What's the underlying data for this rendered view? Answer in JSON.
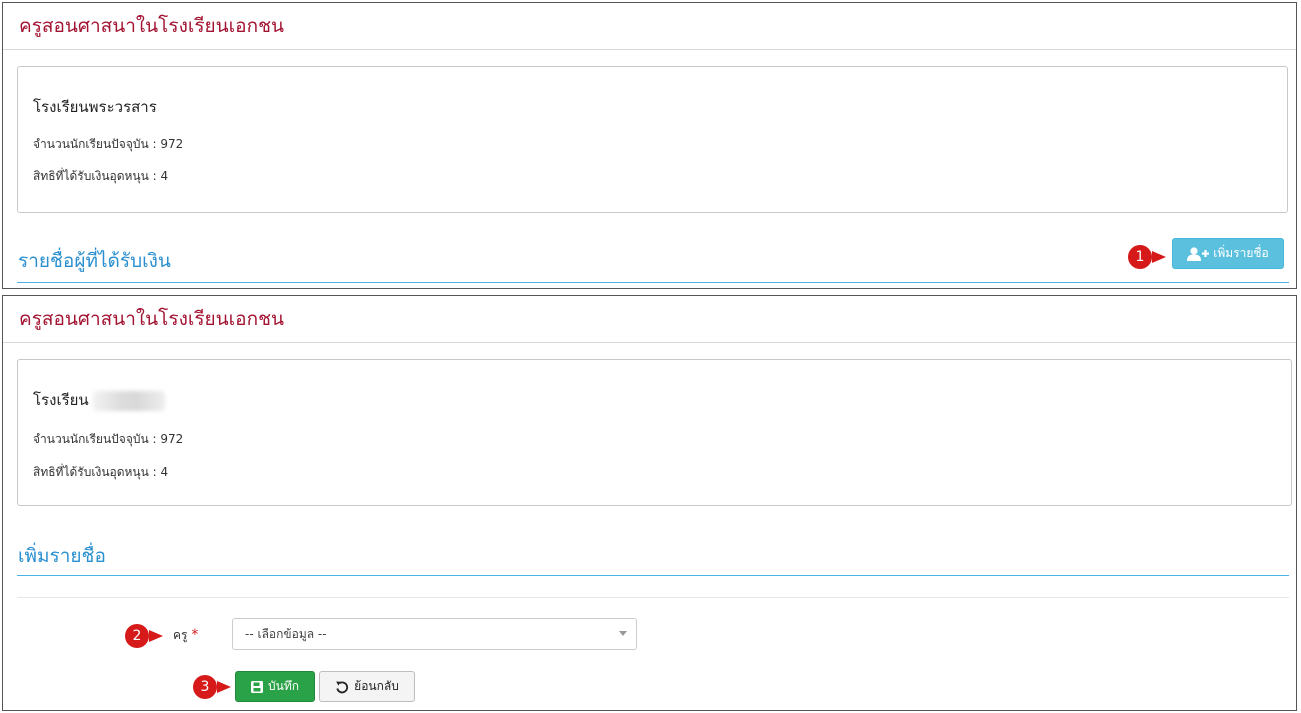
{
  "colors": {
    "header_title": "#a31432",
    "section_title": "#2a8fd0",
    "info_button": "#5bc0de",
    "save_button": "#2aa248",
    "badge": "#d61a1a"
  },
  "panel1": {
    "header_title": "ครูสอนศาสนาในโรงเรียนเอกชน",
    "school_name": "โรงเรียนพระวรสาร",
    "student_count": "จำนวนนักเรียนปัจจุบัน : 972",
    "subsidy_rights": "สิทธิที่ได้รับเงินอุดหนุน : 4",
    "section_title": "รายชื่อผู้ที่ได้รับเงิน",
    "add_button": {
      "label": "เพิ่มรายชื่อ",
      "icon": "user-plus-icon"
    },
    "step_badge": "1"
  },
  "panel2": {
    "header_title": "ครูสอนศาสนาในโรงเรียนเอกชน",
    "school_name": "โรงเรียน",
    "student_count": "จำนวนนักเรียนปัจจุบัน : 972",
    "subsidy_rights": "สิทธิที่ได้รับเงินอุดหนุน : 4",
    "section_title": "เพิ่มรายชื่อ",
    "teacher_label": "ครู",
    "required_mark": "*",
    "teacher_select_value": "-- เลือกข้อมูล --",
    "save_button": {
      "label": "บันทึก",
      "icon": "floppy-disk-icon"
    },
    "back_button": {
      "label": "ย้อนกลับ",
      "icon": "undo-icon"
    },
    "step_badge_2": "2",
    "step_badge_3": "3"
  }
}
